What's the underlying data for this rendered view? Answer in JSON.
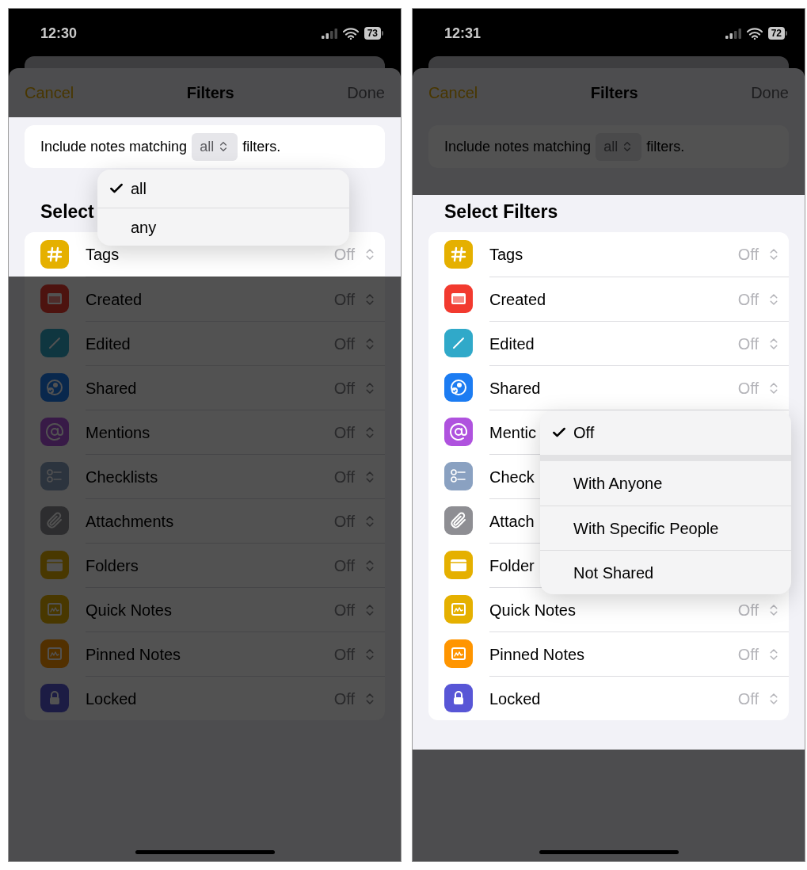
{
  "phones": [
    {
      "status_bar": {
        "time": "12:30",
        "battery": "73"
      },
      "header": {
        "cancel": "Cancel",
        "title": "Filters",
        "done": "Done",
        "dimmed": true
      },
      "match": {
        "prefix": "Include notes matching",
        "value": "all",
        "suffix": "filters.",
        "dimmed": false,
        "menu": {
          "sections": [
            [
              {
                "label": "all",
                "selected": true
              },
              {
                "label": "any",
                "selected": false
              }
            ]
          ]
        }
      },
      "heading": {
        "text": "Select",
        "dimmed": false
      },
      "rows": [
        {
          "label": "Tags",
          "value": "Off",
          "kind": "hash",
          "dimmed": false
        },
        {
          "label": "Created",
          "value": "Off",
          "kind": "calendar",
          "dimmed": true
        },
        {
          "label": "Edited",
          "value": "Off",
          "kind": "pencil",
          "dimmed": true
        },
        {
          "label": "Shared",
          "value": "Off",
          "kind": "people",
          "dimmed": true
        },
        {
          "label": "Mentions",
          "value": "Off",
          "kind": "at",
          "dimmed": true
        },
        {
          "label": "Checklists",
          "value": "Off",
          "kind": "checklist",
          "dimmed": true
        },
        {
          "label": "Attachments",
          "value": "Off",
          "kind": "paperclip",
          "dimmed": true
        },
        {
          "label": "Folders",
          "value": "Off",
          "kind": "folder",
          "dimmed": true
        },
        {
          "label": "Quick Notes",
          "value": "Off",
          "kind": "quicknote",
          "dimmed": true
        },
        {
          "label": "Pinned Notes",
          "value": "Off",
          "kind": "pinnednote",
          "dimmed": true
        },
        {
          "label": "Locked",
          "value": "Off",
          "kind": "lock",
          "dimmed": true
        }
      ]
    },
    {
      "status_bar": {
        "time": "12:31",
        "battery": "72"
      },
      "header": {
        "cancel": "Cancel",
        "title": "Filters",
        "done": "Done",
        "dimmed": true
      },
      "match": {
        "prefix": "Include notes matching",
        "value": "all",
        "suffix": "filters.",
        "dimmed": true
      },
      "heading": {
        "text": "Select Filters",
        "dimmed": false
      },
      "rows": [
        {
          "label": "Tags",
          "value": "Off",
          "kind": "hash",
          "dimmed": false
        },
        {
          "label": "Created",
          "value": "Off",
          "kind": "calendar",
          "dimmed": false
        },
        {
          "label": "Edited",
          "value": "Off",
          "kind": "pencil",
          "dimmed": false
        },
        {
          "label": "Shared",
          "value": "Off",
          "kind": "people",
          "dimmed": false,
          "menu": {
            "sections": [
              [
                {
                  "label": "Off",
                  "selected": true
                }
              ],
              [
                {
                  "label": "With Anyone",
                  "selected": false
                },
                {
                  "label": "With Specific People",
                  "selected": false
                },
                {
                  "label": "Not Shared",
                  "selected": false
                }
              ]
            ]
          }
        },
        {
          "label": "Mentic",
          "kind": "at",
          "dimmed": false
        },
        {
          "label": "Check",
          "kind": "checklist",
          "dimmed": false
        },
        {
          "label": "Attach",
          "kind": "paperclip",
          "dimmed": false
        },
        {
          "label": "Folder",
          "kind": "folder",
          "dimmed": false
        },
        {
          "label": "Quick Notes",
          "value": "Off",
          "kind": "quicknote",
          "dimmed": false
        },
        {
          "label": "Pinned Notes",
          "value": "Off",
          "kind": "pinnednote",
          "dimmed": false
        },
        {
          "label": "Locked",
          "value": "Off",
          "kind": "lock",
          "dimmed": false
        }
      ]
    }
  ]
}
